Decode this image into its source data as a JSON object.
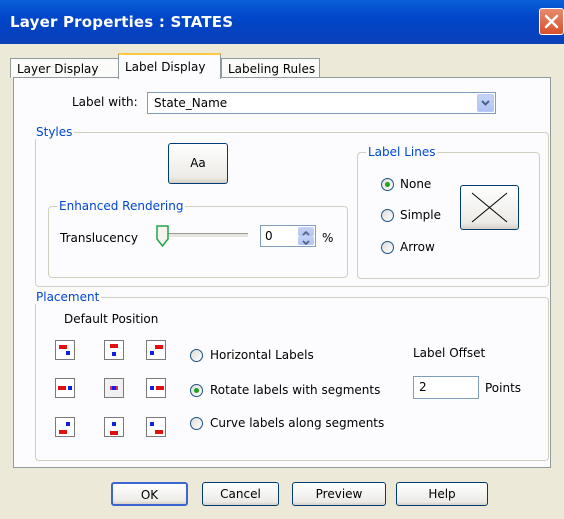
{
  "window": {
    "title": "Layer Properties  : STATES"
  },
  "tabs": [
    {
      "label": "Layer Display",
      "active": false
    },
    {
      "label": "Label Display",
      "active": true
    },
    {
      "label": "Labeling Rules",
      "active": false
    }
  ],
  "label_with": {
    "label": "Label with:",
    "value": "State_Name"
  },
  "styles": {
    "title": "Styles",
    "font_button": "Aa",
    "enhanced_rendering": {
      "title": "Enhanced Rendering",
      "translucency_label": "Translucency",
      "translucency_value": "0",
      "unit": "%",
      "slider_level": 0
    },
    "label_lines": {
      "title": "Label Lines",
      "options": [
        "None",
        "Simple",
        "Arrow"
      ],
      "selected": "None"
    }
  },
  "placement": {
    "title": "Placement",
    "default_position": "Default Position",
    "options": [
      "Horizontal Labels",
      "Rotate labels with segments",
      "Curve labels along segments"
    ],
    "selected": "Rotate labels with segments",
    "offset_label": "Label Offset",
    "offset_value": "2",
    "offset_unit": "Points"
  },
  "buttons": {
    "ok": "OK",
    "cancel": "Cancel",
    "preview": "Preview",
    "help": "Help"
  },
  "colors": {
    "title_bar": "#0046c8",
    "group_title": "#0046d5",
    "active_tab_accent": "#ffc83c",
    "close_button": "#d7502b"
  }
}
